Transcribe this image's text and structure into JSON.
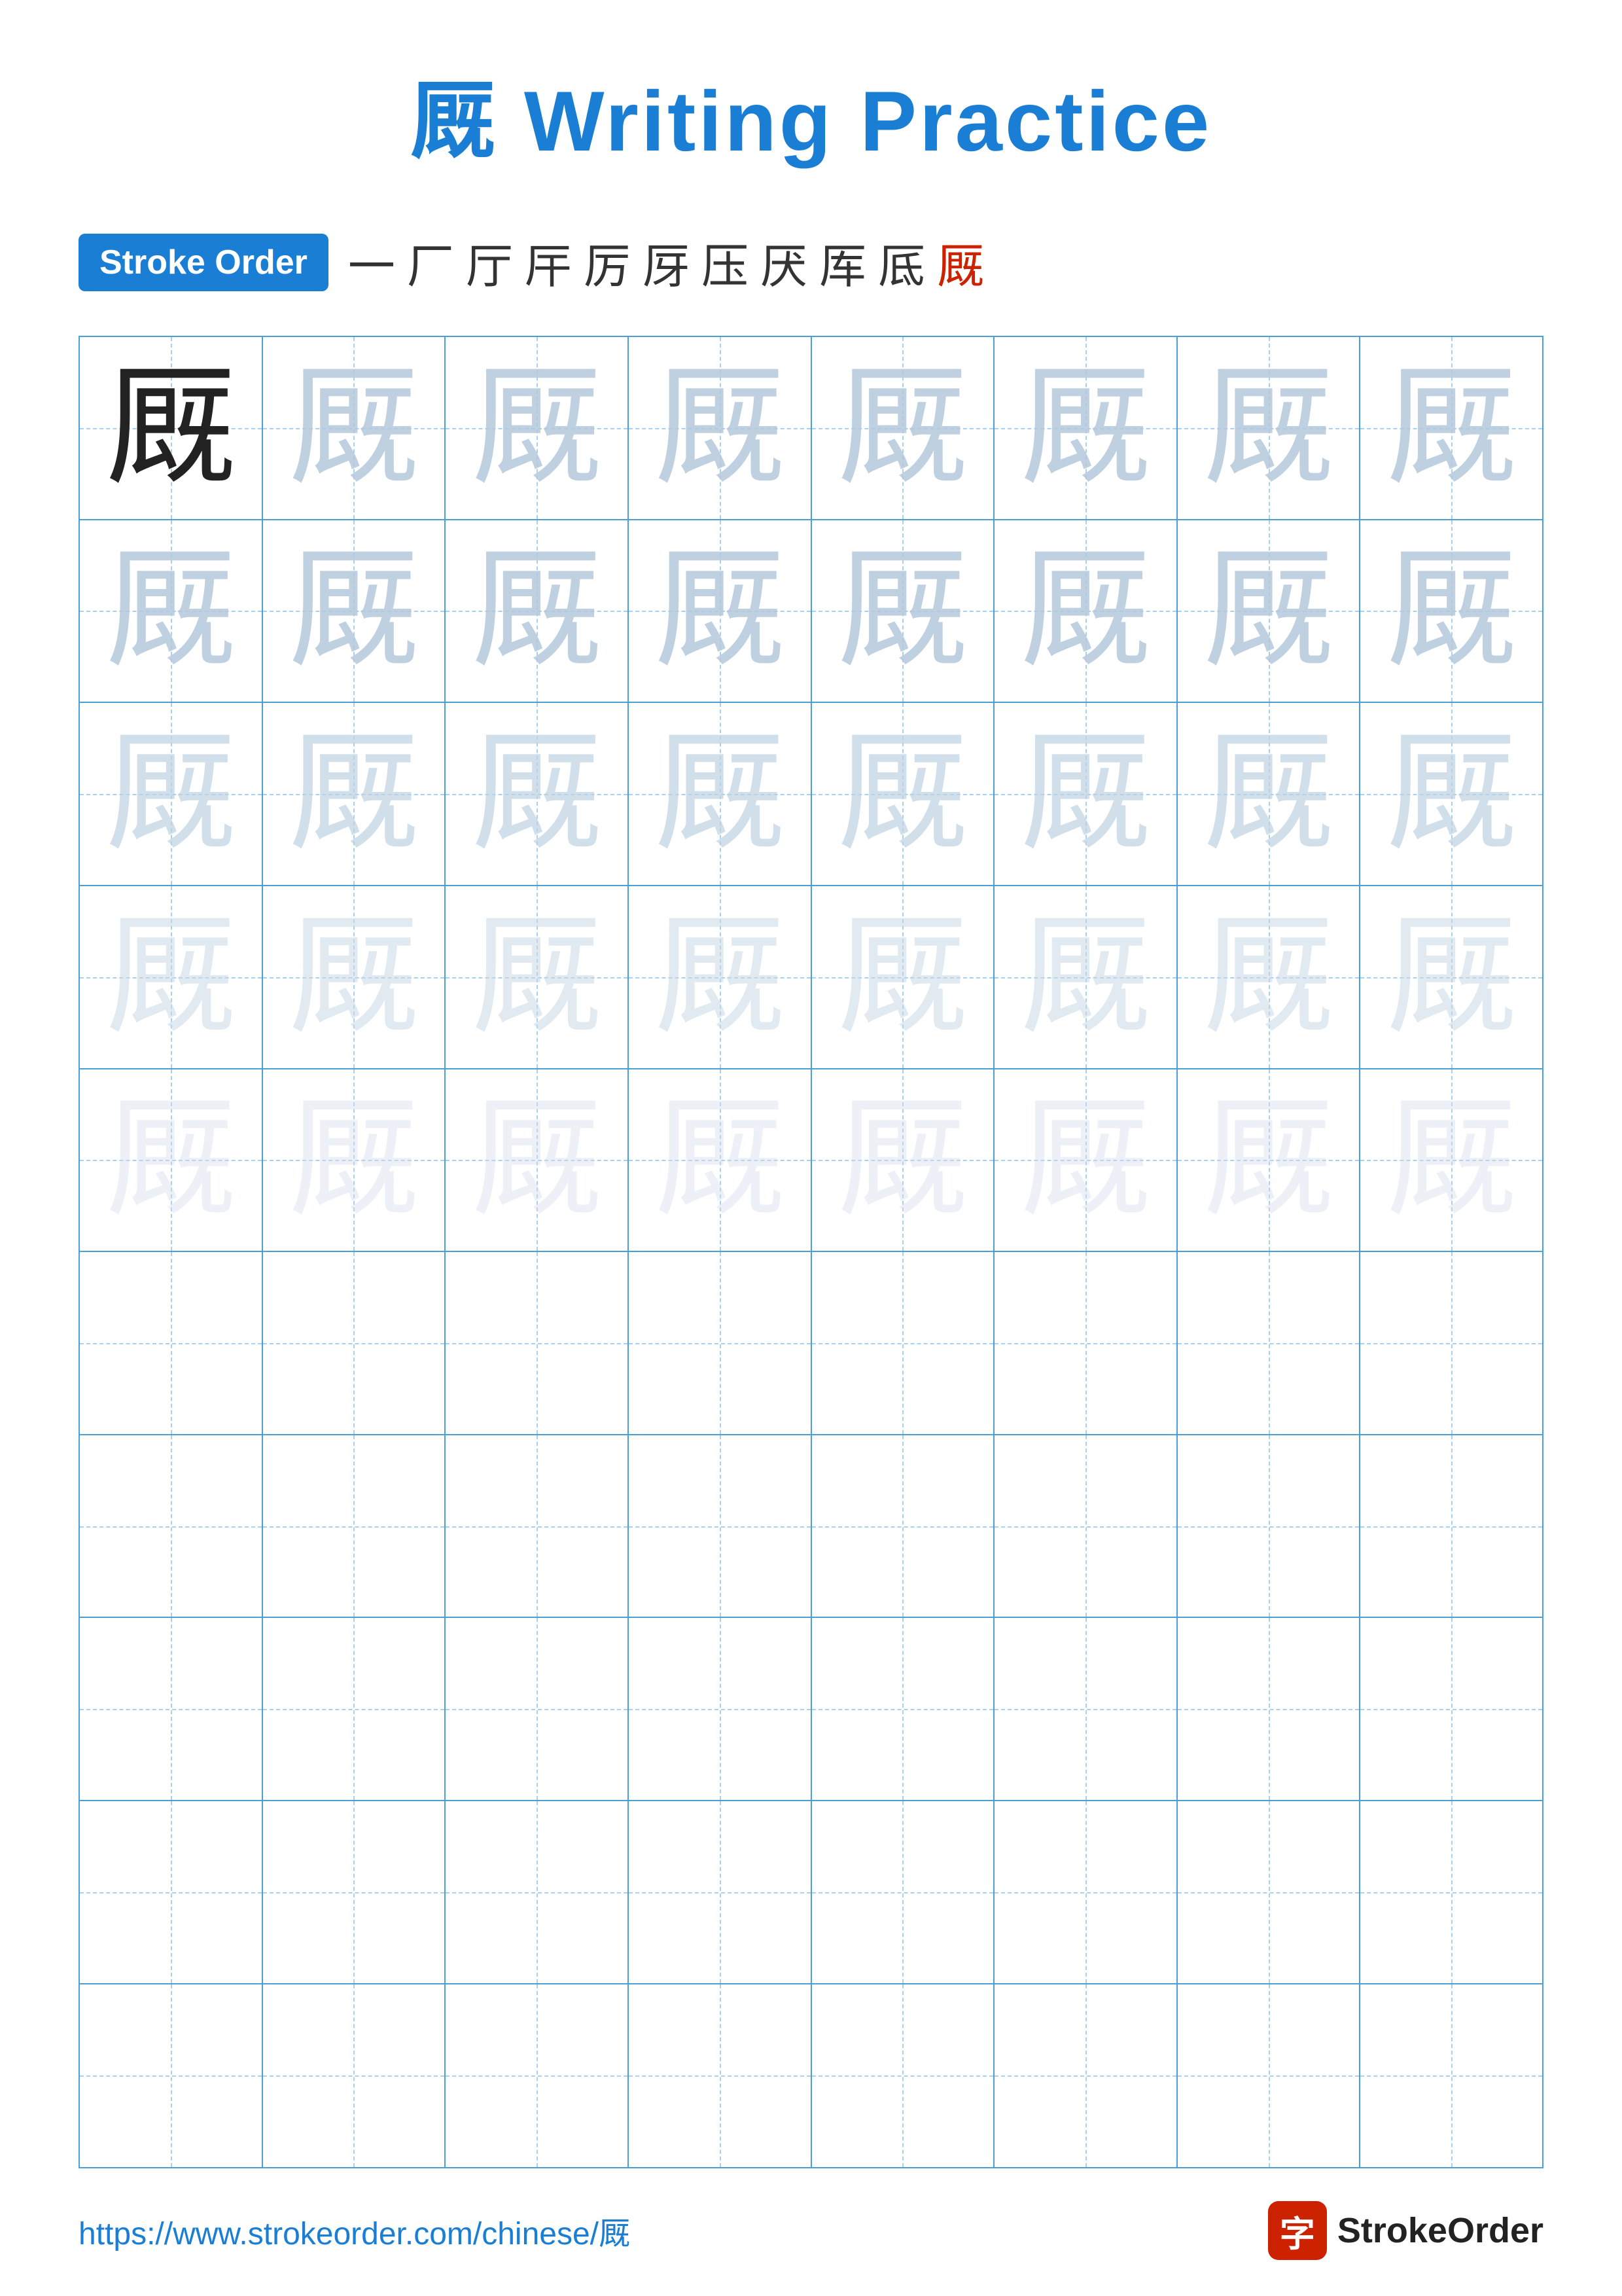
{
  "title": {
    "char": "厩",
    "text": " Writing Practice",
    "full": "厩 Writing Practice"
  },
  "stroke_order": {
    "badge_label": "Stroke Order",
    "strokes": [
      "一",
      "厂",
      "厅",
      "厈",
      "厉",
      "厊",
      "压",
      "厌",
      "厍",
      "厎",
      "厩"
    ]
  },
  "character": "厩",
  "grid": {
    "rows": 10,
    "cols": 8,
    "filled_rows": 5
  },
  "footer": {
    "url": "https://www.strokeorder.com/chinese/厩",
    "logo_char": "字",
    "logo_text": "StrokeOrder"
  }
}
